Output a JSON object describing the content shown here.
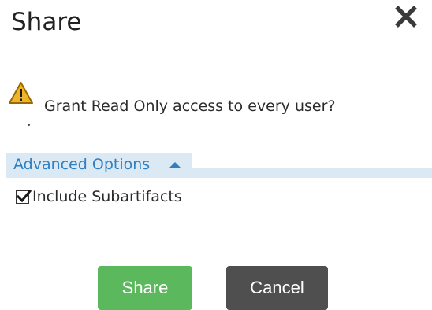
{
  "dialog": {
    "title": "Share",
    "close_icon": "close-icon",
    "message": "Grant Read Only access to every user?",
    "warning_icon": "warning-icon",
    "warning_color": "#f0b429"
  },
  "advanced": {
    "label": "Advanced Options",
    "expanded": true,
    "accent": "#2f7fc1",
    "tab_bg": "#dbe9f5",
    "include_subartifacts": {
      "label": "Include Subartifacts",
      "checked": true
    }
  },
  "buttons": {
    "share_label": "Share",
    "share_color": "#5cb85c",
    "cancel_label": "Cancel",
    "cancel_color": "#4f4f4f"
  }
}
